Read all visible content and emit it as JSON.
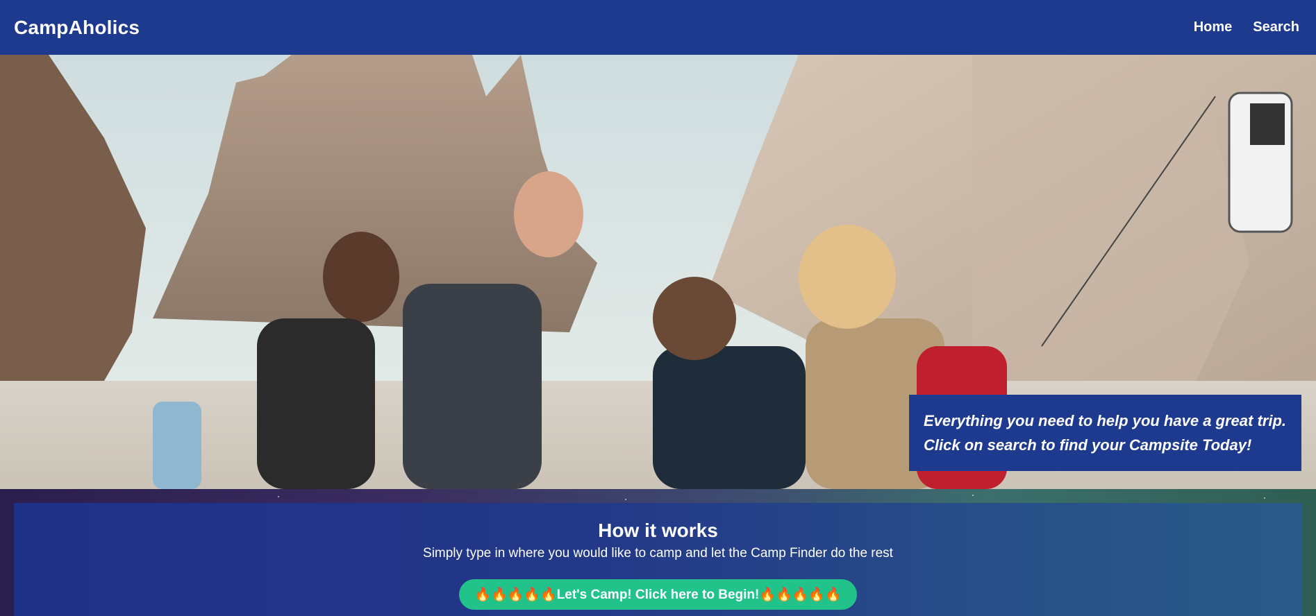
{
  "header": {
    "brand": "CampAholics",
    "nav": {
      "home": "Home",
      "search": "Search"
    }
  },
  "hero": {
    "tagline_line1": "Everything you need to help you have a great trip.",
    "tagline_line2": "Click on search to find your Campsite Today!"
  },
  "how_it_works": {
    "title": "How it works",
    "subtitle": "Simply type in where you would like to camp and let the Camp Finder do the rest",
    "cta_label": "🔥🔥🔥🔥🔥Let's Camp! Click here to Begin!🔥🔥🔥🔥🔥"
  },
  "colors": {
    "navbar": "#1e3a8f",
    "cta": "#22c38a"
  }
}
